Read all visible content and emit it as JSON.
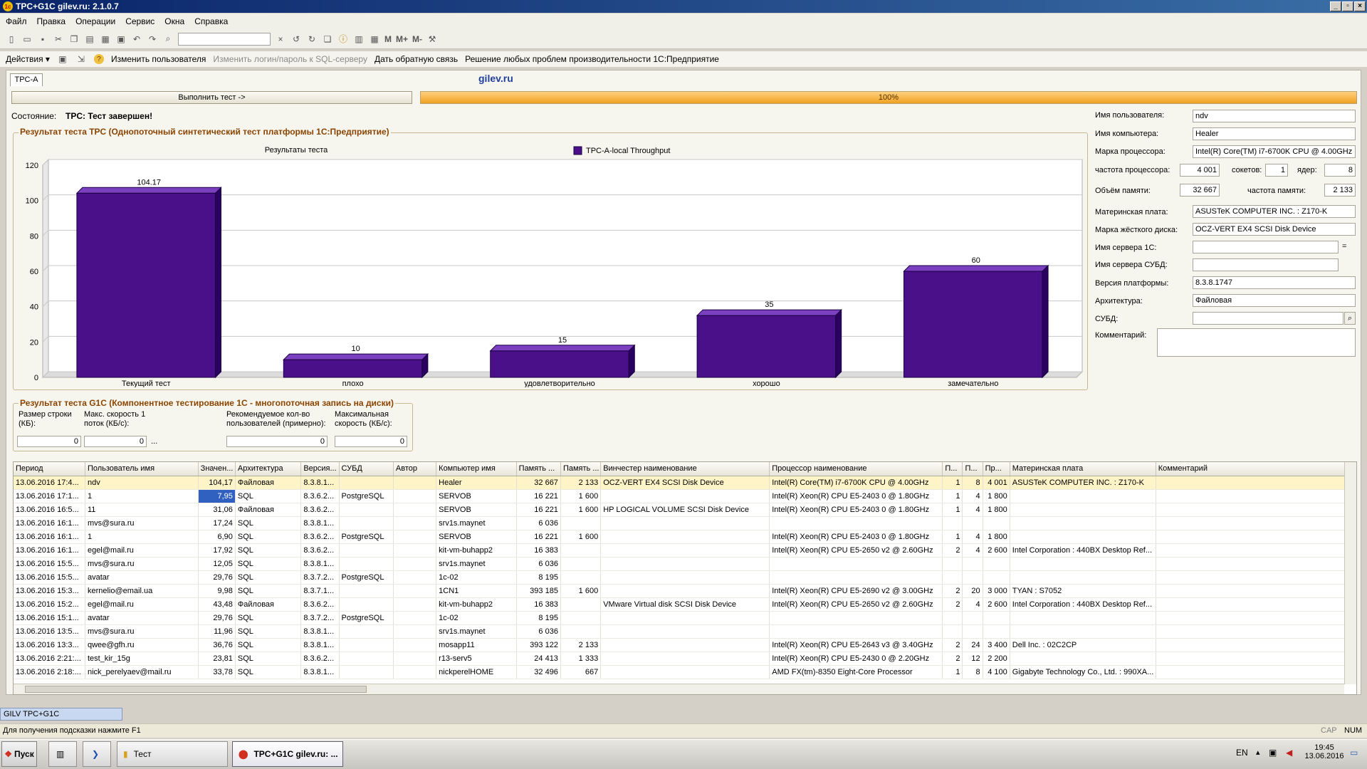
{
  "window": {
    "title": "TPC+G1C gilev.ru: 2.1.0.7",
    "logo_text": "1с"
  },
  "menu": [
    "Файл",
    "Правка",
    "Операции",
    "Сервис",
    "Окна",
    "Справка"
  ],
  "toolbar": {
    "mem_buttons": [
      "M",
      "M+",
      "M-"
    ]
  },
  "actions": {
    "menu_label": "Действия",
    "items": [
      "Изменить пользователя",
      "Изменить логин/пароль к SQL-серверу",
      "Дать обратную связь",
      "Решение любых проблем производительности 1С:Предприятие"
    ]
  },
  "tab": {
    "label": "TPC-A",
    "site": "gilev.ru"
  },
  "run": {
    "button_label": "Выполнить тест ->",
    "progress": "100%"
  },
  "state": {
    "label": "Состояние:",
    "value": "TPC: Тест завершен!"
  },
  "chart_group_title": "Результат теста TPC (Однопоточный синтетический тест платформы 1С:Предприятие)",
  "chart_data": {
    "type": "bar",
    "title": "Результаты теста",
    "categories": [
      "Текущий тест",
      "плохо",
      "удовлетворительно",
      "хорошо",
      "замечательно"
    ],
    "series": [
      {
        "name": "TPC-A-local Throughput",
        "values": [
          104.17,
          10,
          15,
          35,
          60
        ]
      }
    ],
    "value_labels": [
      "104.17",
      "10",
      "15",
      "35",
      "60"
    ],
    "ylim": [
      0,
      120
    ],
    "yticks": [
      "0",
      "20",
      "40",
      "60",
      "80",
      "100",
      "120"
    ],
    "bar_color": "#4a108a",
    "grid": true,
    "legend": "top"
  },
  "info": {
    "user_label": "Имя пользователя:",
    "user": "ndv",
    "computer_label": "Имя компьютера:",
    "computer": "Healer",
    "cpu_label": "Марка процессора:",
    "cpu": "Intel(R) Core(TM) i7-6700K CPU @ 4.00GHz",
    "freq_label": "частота процессора:",
    "freq": "4 001",
    "sockets_label": "сокетов:",
    "sockets": "1",
    "cores_label": "ядер:",
    "cores": "8",
    "ram_label": "Объём памяти:",
    "ram": "32 667",
    "ram_freq_label": "частота памяти:",
    "ram_freq": "2 133",
    "board_label": "Материнская плата:",
    "board": "ASUSTeK COMPUTER INC. : Z170-K",
    "disk_label": "Марка жёсткого диска:",
    "disk": "OCZ-VERT EX4 SCSI Disk Device",
    "server1c_label": "Имя сервера 1С:",
    "server1c": "",
    "serverdb_label": "Имя сервера СУБД:",
    "serverdb": "",
    "platform_label": "Версия платформы:",
    "platform": "8.3.8.1747",
    "arch_label": "Архитектура:",
    "arch": "Файловая",
    "dbms_label": "СУБД:",
    "dbms": "",
    "comment_label": "Комментарий:",
    "comment": ""
  },
  "g1c": {
    "title": "Результат теста G1C (Компонентное тестирование 1С - многопоточная запись на диски)",
    "row_size_label": "Размер строки (КБ):",
    "row_size": "0",
    "max_speed1_label": "Макс. скорость 1 поток (КБ/с):",
    "max_speed1": "0",
    "users_label": "Рекомендуемое кол-во пользователей (примерно):",
    "users": "0",
    "max_speed_label": "Максимальная скорость (КБ/с):",
    "max_speed": "0",
    "ellipsis": "..."
  },
  "table": {
    "columns": [
      "Период",
      "Пользователь имя",
      "Значен...",
      "Архитектура",
      "Версия...",
      "СУБД",
      "Автор",
      "Компьютер имя",
      "Память ...",
      "Память ...",
      "Винчестер наименование",
      "Процессор наименование",
      "П...",
      "П...",
      "Пр...",
      "Материнская плата",
      "Комментарий"
    ],
    "rows": [
      [
        "13.06.2016 17:4...",
        "ndv",
        "104,17",
        "Файловая",
        "8.3.8.1...",
        "",
        "",
        "Healer",
        "32 667",
        "2 133",
        "OCZ-VERT EX4 SCSI Disk Device",
        "Intel(R) Core(TM) i7-6700K CPU @ 4.00GHz",
        "1",
        "8",
        "4 001",
        "ASUSTeK COMPUTER INC. : Z170-K",
        ""
      ],
      [
        "13.06.2016 17:1...",
        "1",
        "7,95",
        "SQL",
        "8.3.6.2...",
        "PostgreSQL",
        "",
        "SERVOB",
        "16 221",
        "1 600",
        "",
        "Intel(R) Xeon(R) CPU E5-2403 0 @ 1.80GHz",
        "1",
        "4",
        "1 800",
        "",
        ""
      ],
      [
        "13.06.2016 16:5...",
        "11",
        "31,06",
        "Файловая",
        "8.3.6.2...",
        "",
        "",
        "SERVOB",
        "16 221",
        "1 600",
        "HP LOGICAL VOLUME SCSI Disk Device",
        "Intel(R) Xeon(R) CPU E5-2403 0 @ 1.80GHz",
        "1",
        "4",
        "1 800",
        "",
        ""
      ],
      [
        "13.06.2016 16:1...",
        "mvs@sura.ru",
        "17,24",
        "SQL",
        "8.3.8.1...",
        "",
        "",
        "srv1s.maynet",
        "6 036",
        "",
        "",
        "",
        "",
        "",
        "",
        "",
        ""
      ],
      [
        "13.06.2016 16:1...",
        "1",
        "6,90",
        "SQL",
        "8.3.6.2...",
        "PostgreSQL",
        "",
        "SERVOB",
        "16 221",
        "1 600",
        "",
        "Intel(R) Xeon(R) CPU E5-2403 0 @ 1.80GHz",
        "1",
        "4",
        "1 800",
        "",
        ""
      ],
      [
        "13.06.2016 16:1...",
        "egel@mail.ru",
        "17,92",
        "SQL",
        "8.3.6.2...",
        "",
        "",
        "kit-vm-buhapp2",
        "16 383",
        "",
        "",
        "Intel(R) Xeon(R) CPU E5-2650 v2 @ 2.60GHz",
        "2",
        "4",
        "2 600",
        "Intel Corporation : 440BX Desktop Ref...",
        ""
      ],
      [
        "13.06.2016 15:5...",
        "mvs@sura.ru",
        "12,05",
        "SQL",
        "8.3.8.1...",
        "",
        "",
        "srv1s.maynet",
        "6 036",
        "",
        "",
        "",
        "",
        "",
        "",
        "",
        ""
      ],
      [
        "13.06.2016 15:5...",
        "avatar",
        "29,76",
        "SQL",
        "8.3.7.2...",
        "PostgreSQL",
        "",
        "1c-02",
        "8 195",
        "",
        "",
        "",
        "",
        "",
        "",
        "",
        ""
      ],
      [
        "13.06.2016 15:3...",
        "kernelio@email.ua",
        "9,98",
        "SQL",
        "8.3.7.1...",
        "",
        "",
        "1CN1",
        "393 185",
        "1 600",
        "",
        "Intel(R) Xeon(R) CPU E5-2690 v2 @ 3.00GHz",
        "2",
        "20",
        "3 000",
        "TYAN : S7052",
        ""
      ],
      [
        "13.06.2016 15:2...",
        "egel@mail.ru",
        "43,48",
        "Файловая",
        "8.3.6.2...",
        "",
        "",
        "kit-vm-buhapp2",
        "16 383",
        "",
        "VMware Virtual disk SCSI Disk Device",
        "Intel(R) Xeon(R) CPU E5-2650 v2 @ 2.60GHz",
        "2",
        "4",
        "2 600",
        "Intel Corporation : 440BX Desktop Ref...",
        ""
      ],
      [
        "13.06.2016 15:1...",
        "avatar",
        "29,76",
        "SQL",
        "8.3.7.2...",
        "PostgreSQL",
        "",
        "1c-02",
        "8 195",
        "",
        "",
        "",
        "",
        "",
        "",
        "",
        ""
      ],
      [
        "13.06.2016 13:5...",
        "mvs@sura.ru",
        "11,96",
        "SQL",
        "8.3.8.1...",
        "",
        "",
        "srv1s.maynet",
        "6 036",
        "",
        "",
        "",
        "",
        "",
        "",
        "",
        ""
      ],
      [
        "13.06.2016 13:3...",
        "qwee@gfh.ru",
        "36,76",
        "SQL",
        "8.3.8.1...",
        "",
        "",
        "mosapp11",
        "393 122",
        "2 133",
        "",
        "Intel(R) Xeon(R) CPU E5-2643 v3 @ 3.40GHz",
        "2",
        "24",
        "3 400",
        "Dell Inc. : 02C2CP",
        ""
      ],
      [
        "13.06.2016 2:21:...",
        "test_kir_15g",
        "23,81",
        "SQL",
        "8.3.6.2...",
        "",
        "",
        "r13-serv5",
        "24 413",
        "1 333",
        "",
        "Intel(R) Xeon(R) CPU E5-2430 0 @ 2.20GHz",
        "2",
        "12",
        "2 200",
        "",
        ""
      ],
      [
        "13.06.2016 2:18:...",
        "nick_perelyaev@mail.ru",
        "33,78",
        "SQL",
        "8.3.8.1...",
        "",
        "",
        "nickperelHOME",
        "32 496",
        "667",
        "",
        "AMD FX(tm)-8350 Eight-Core Processor",
        "1",
        "8",
        "4 100",
        "Gigabyte Technology Co., Ltd. : 990XA...",
        ""
      ]
    ]
  },
  "task_window": "GILV TPC+G1C",
  "status": {
    "hint": "Для получения подсказки нажмите F1",
    "caps": "CAP",
    "num": "NUM"
  },
  "taskbar": {
    "start": "Пуск",
    "folder": "Тест",
    "app": "TPC+G1C gilev.ru: ...",
    "lang": "EN",
    "time": "19:45",
    "date": "13.06.2016"
  }
}
